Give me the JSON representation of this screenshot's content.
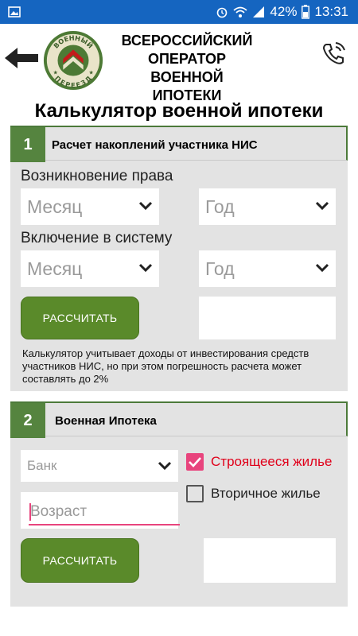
{
  "status_bar": {
    "battery": "42%",
    "time": "13:31",
    "colors": {
      "bg": "#1565c0"
    }
  },
  "header": {
    "back_icon": "arrow-left-icon",
    "logo_text_top": "ВОЕННЫЙ",
    "logo_text_bottom": "ПЕРЕЕЗД",
    "org_title_line1": "ВСЕРОССИЙСКИЙ",
    "org_title_line2": "ОПЕРАТОР ВОЕННОЙ",
    "org_title_line3": "ИПОТЕКИ",
    "phone_icon": "phone-ring-icon"
  },
  "page_title": "Калькулятор военной ипотеки",
  "section1": {
    "number": "1",
    "title": "Расчет накоплений участника НИС",
    "right_label": "Возникновение права",
    "right_month": "Месяц",
    "right_year": "Год",
    "system_label": "Включение в систему",
    "system_month": "Месяц",
    "system_year": "Год",
    "calc_button": "РАССЧИТАТЬ",
    "result": "",
    "note": "Калькулятор учитывает доходы от инвестирования средств участников НИС, но при этом погрешность расчета может составлять до 2%"
  },
  "section2": {
    "number": "2",
    "title": "Военная Ипотека",
    "bank_placeholder": "Банк",
    "age_placeholder": "Возраст",
    "option_new": "Строящееся жилье",
    "option_new_checked": true,
    "option_secondary": "Вторичное жилье",
    "option_secondary_checked": false,
    "calc_button": "РАССЧИТАТЬ",
    "result": ""
  },
  "colors": {
    "accent_green": "#5a8a2a",
    "check_pink": "#e8447d",
    "checked_text": "#e0001a"
  }
}
